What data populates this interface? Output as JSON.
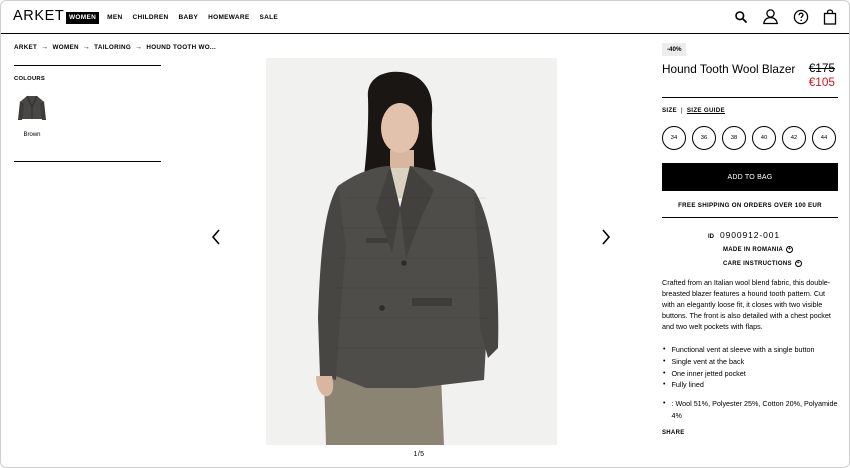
{
  "header": {
    "logo": "ARKET",
    "nav": [
      "WOMEN",
      "MEN",
      "CHILDREN",
      "BABY",
      "HOMEWARE",
      "SALE"
    ],
    "icons": [
      "search-icon",
      "account-icon",
      "help-icon",
      "bag-icon"
    ]
  },
  "breadcrumb": [
    "ARKET",
    "WOMEN",
    "TAILORING",
    "HOUND TOOTH WO..."
  ],
  "colours": {
    "label": "COLOURS",
    "items": [
      {
        "name": "Brown"
      }
    ]
  },
  "gallery": {
    "counter": "1/5"
  },
  "product": {
    "discount": "-40%",
    "title": "Hound Tooth Wool Blazer",
    "price_old": "€175",
    "price_new": "€105",
    "price_new_color": "#d0161c",
    "size_label": "SIZE",
    "size_guide": "SIZE GUIDE",
    "sizes": [
      "34",
      "36",
      "38",
      "40",
      "42",
      "44"
    ],
    "add_to_bag": "ADD TO BAG",
    "shipping": "FREE SHIPPING ON ORDERS OVER 100 EUR",
    "id_label": "ID",
    "id_value": "0900912-001",
    "made_in": "MADE IN ROMANIA",
    "care": "CARE INSTRUCTIONS",
    "description": "Crafted from an Italian wool blend fabric, this double-breasted blazer features a hound tooth pattern. Cut with an elegantly loose fit, it closes with two visible buttons.  The front is also detailed with a chest pocket and two welt pockets with flaps.",
    "bullets": [
      "Functional vent at sleeve with a single button",
      "Single vent at the back",
      "One inner jetted pocket",
      "Fully lined"
    ],
    "material": ": Wool 51%, Polyester 25%, Cotton 20%, Polyamide 4%",
    "share": "SHARE"
  }
}
